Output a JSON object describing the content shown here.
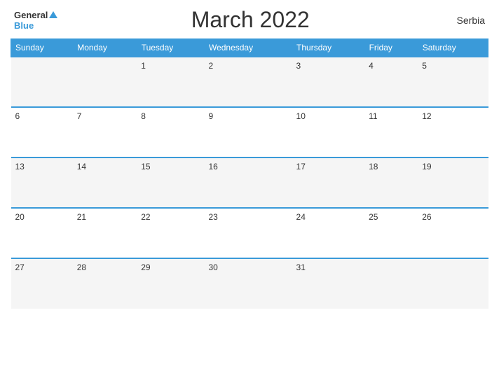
{
  "header": {
    "logo_general": "General",
    "logo_blue": "Blue",
    "title": "March 2022",
    "country": "Serbia"
  },
  "days_of_week": [
    "Sunday",
    "Monday",
    "Tuesday",
    "Wednesday",
    "Thursday",
    "Friday",
    "Saturday"
  ],
  "weeks": [
    [
      "",
      "",
      "1",
      "2",
      "3",
      "4",
      "5"
    ],
    [
      "6",
      "7",
      "8",
      "9",
      "10",
      "11",
      "12"
    ],
    [
      "13",
      "14",
      "15",
      "16",
      "17",
      "18",
      "19"
    ],
    [
      "20",
      "21",
      "22",
      "23",
      "24",
      "25",
      "26"
    ],
    [
      "27",
      "28",
      "29",
      "30",
      "31",
      "",
      ""
    ]
  ]
}
